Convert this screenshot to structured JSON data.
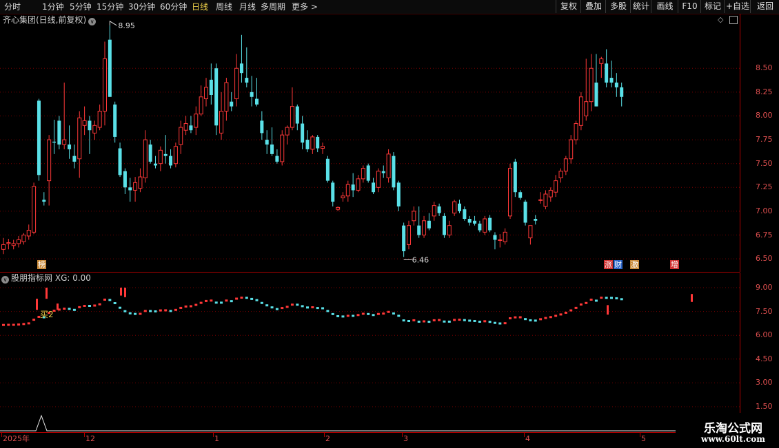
{
  "toolbar": {
    "timeframes": [
      "分时",
      "1分钟",
      "5分钟",
      "15分钟",
      "30分钟",
      "60分钟",
      "日线",
      "周线",
      "月线",
      "多周期",
      "更多 >"
    ],
    "active_index": 6,
    "right_buttons": [
      "复权",
      "叠加",
      "多股",
      "统计",
      "画线",
      "F10",
      "标记",
      "+自选",
      "返回"
    ]
  },
  "price_panel": {
    "title": "齐心集团(日线,前复权)",
    "high_label": "8.95",
    "low_label": "6.46",
    "y_ticks": [
      "8.50",
      "8.25",
      "8.00",
      "7.75",
      "7.50",
      "7.25",
      "7.00",
      "6.75",
      "6.50"
    ],
    "event_badges": [
      {
        "text": "榜",
        "color": "#c88a3a"
      },
      {
        "text": "涨",
        "color": "#d03030"
      },
      {
        "text": "财",
        "color": "#2a64c8"
      },
      {
        "text": "激",
        "color": "#c88a3a"
      },
      {
        "text": "增",
        "color": "#d03030"
      }
    ]
  },
  "indicator_panel": {
    "title": "股朋指标网",
    "xg_label": "XG: 0.00",
    "signal_label": "买2",
    "y_ticks": [
      "9.00",
      "7.50",
      "6.00",
      "4.50",
      "3.00",
      "1.50"
    ]
  },
  "x_axis": {
    "labels": [
      "2025年",
      "12",
      "1",
      "2",
      "3",
      "4",
      "5"
    ]
  },
  "watermark": {
    "title": "乐淘公式网",
    "url": "www.60lt.com"
  },
  "colors": {
    "up": "#ff3838",
    "down": "#5ae1e8",
    "grid": "#7a0000",
    "axis_text": "#e05050",
    "active_tab": "#f0d24a"
  },
  "chart_data": {
    "type": "candlestick",
    "ylim": [
      6.4,
      9.0
    ],
    "candles": [
      [
        6.6,
        6.72,
        6.55,
        6.65
      ],
      [
        6.66,
        6.71,
        6.6,
        6.67
      ],
      [
        6.64,
        6.7,
        6.6,
        6.66
      ],
      [
        6.66,
        6.74,
        6.62,
        6.7
      ],
      [
        6.68,
        6.77,
        6.65,
        6.75
      ],
      [
        6.74,
        6.86,
        6.7,
        6.8
      ],
      [
        6.78,
        7.3,
        6.76,
        7.26
      ],
      [
        8.16,
        8.18,
        7.32,
        7.38
      ],
      [
        7.12,
        7.2,
        7.06,
        7.1
      ],
      [
        7.32,
        7.8,
        7.06,
        7.75
      ],
      [
        7.73,
        7.96,
        7.6,
        7.72
      ],
      [
        7.95,
        8.0,
        7.65,
        7.7
      ],
      [
        7.7,
        8.35,
        7.65,
        7.75
      ],
      [
        7.7,
        7.9,
        7.55,
        7.65
      ],
      [
        7.58,
        7.7,
        7.45,
        7.52
      ],
      [
        7.55,
        8.05,
        7.35,
        7.98
      ],
      [
        7.9,
        8.1,
        7.8,
        7.95
      ],
      [
        7.95,
        8.0,
        7.6,
        7.85
      ],
      [
        7.82,
        7.95,
        7.75,
        7.9
      ],
      [
        7.88,
        8.12,
        7.85,
        8.05
      ],
      [
        8.05,
        8.78,
        7.9,
        8.6
      ],
      [
        8.8,
        8.95,
        8.2,
        8.2
      ],
      [
        8.12,
        8.15,
        7.72,
        7.78
      ],
      [
        7.66,
        7.72,
        7.36,
        7.38
      ],
      [
        7.42,
        7.45,
        7.18,
        7.25
      ],
      [
        7.25,
        7.35,
        7.1,
        7.22
      ],
      [
        7.22,
        7.36,
        7.1,
        7.3
      ],
      [
        7.24,
        7.45,
        7.2,
        7.36
      ],
      [
        7.35,
        7.85,
        7.3,
        7.75
      ],
      [
        7.7,
        7.75,
        7.5,
        7.52
      ],
      [
        7.5,
        7.58,
        7.45,
        7.48
      ],
      [
        7.5,
        7.68,
        7.42,
        7.64
      ],
      [
        7.6,
        7.8,
        7.5,
        7.58
      ],
      [
        7.58,
        7.65,
        7.45,
        7.48
      ],
      [
        7.5,
        7.72,
        7.46,
        7.68
      ],
      [
        7.7,
        7.95,
        7.6,
        7.88
      ],
      [
        7.85,
        8.0,
        7.8,
        7.92
      ],
      [
        7.9,
        8.0,
        7.82,
        7.85
      ],
      [
        7.88,
        8.1,
        7.8,
        8.02
      ],
      [
        8.02,
        8.32,
        8.0,
        8.2
      ],
      [
        8.18,
        8.4,
        8.1,
        8.3
      ],
      [
        8.38,
        8.55,
        8.12,
        8.22
      ],
      [
        8.5,
        8.55,
        7.8,
        7.9
      ],
      [
        7.82,
        8.25,
        7.75,
        8.05
      ],
      [
        8.05,
        8.4,
        7.95,
        8.35
      ],
      [
        8.15,
        8.25,
        8.05,
        8.1
      ],
      [
        8.18,
        8.65,
        8.1,
        8.5
      ],
      [
        8.55,
        8.85,
        8.35,
        8.45
      ],
      [
        8.4,
        8.72,
        8.3,
        8.35
      ],
      [
        8.25,
        8.42,
        8.1,
        8.2
      ],
      [
        8.18,
        8.4,
        8.1,
        8.12
      ],
      [
        7.95,
        8.05,
        7.75,
        7.82
      ],
      [
        7.75,
        7.85,
        7.6,
        7.7
      ],
      [
        7.7,
        7.88,
        7.58,
        7.6
      ],
      [
        7.58,
        7.65,
        7.5,
        7.52
      ],
      [
        7.52,
        7.85,
        7.48,
        7.8
      ],
      [
        7.8,
        7.9,
        7.7,
        7.88
      ],
      [
        7.88,
        8.3,
        7.85,
        8.1
      ],
      [
        8.1,
        8.12,
        7.85,
        7.92
      ],
      [
        7.92,
        8.0,
        7.65,
        7.72
      ],
      [
        7.75,
        7.85,
        7.62,
        7.65
      ],
      [
        7.65,
        7.8,
        7.6,
        7.78
      ],
      [
        7.78,
        7.8,
        7.62,
        7.66
      ],
      [
        7.66,
        7.72,
        7.6,
        7.68
      ],
      [
        7.55,
        7.58,
        7.3,
        7.32
      ],
      [
        7.3,
        7.32,
        7.05,
        7.1
      ],
      [
        7.02,
        7.05,
        7.0,
        7.04
      ],
      [
        7.14,
        7.2,
        7.1,
        7.16
      ],
      [
        7.16,
        7.32,
        7.1,
        7.28
      ],
      [
        7.28,
        7.4,
        7.15,
        7.22
      ],
      [
        7.22,
        7.38,
        7.2,
        7.34
      ],
      [
        7.34,
        7.48,
        7.3,
        7.45
      ],
      [
        7.48,
        7.5,
        7.3,
        7.32
      ],
      [
        7.3,
        7.35,
        7.18,
        7.2
      ],
      [
        7.25,
        7.45,
        7.2,
        7.42
      ],
      [
        7.42,
        7.48,
        7.35,
        7.4
      ],
      [
        7.35,
        7.65,
        7.3,
        7.6
      ],
      [
        7.58,
        7.62,
        7.22,
        7.25
      ],
      [
        7.3,
        7.32,
        7.0,
        7.05
      ],
      [
        6.85,
        6.88,
        6.52,
        6.58
      ],
      [
        6.65,
        6.9,
        6.6,
        6.85
      ],
      [
        6.9,
        7.05,
        6.85,
        7.0
      ],
      [
        6.85,
        7.05,
        6.72,
        6.75
      ],
      [
        6.75,
        6.95,
        6.72,
        6.9
      ],
      [
        6.9,
        6.98,
        6.8,
        6.82
      ],
      [
        6.95,
        7.1,
        6.9,
        7.06
      ],
      [
        7.05,
        7.08,
        6.95,
        6.98
      ],
      [
        6.95,
        6.98,
        6.72,
        6.75
      ],
      [
        6.75,
        6.9,
        6.72,
        6.85
      ],
      [
        6.98,
        7.12,
        6.95,
        7.1
      ],
      [
        7.08,
        7.12,
        6.98,
        7.0
      ],
      [
        7.02,
        7.05,
        6.9,
        6.92
      ],
      [
        6.92,
        6.95,
        6.85,
        6.88
      ],
      [
        6.9,
        6.95,
        6.85,
        6.87
      ],
      [
        6.87,
        6.9,
        6.78,
        6.8
      ],
      [
        6.78,
        6.95,
        6.75,
        6.92
      ],
      [
        6.93,
        6.96,
        6.78,
        6.8
      ],
      [
        6.75,
        6.78,
        6.6,
        6.7
      ],
      [
        6.7,
        6.76,
        6.62,
        6.7
      ],
      [
        6.68,
        6.82,
        6.65,
        6.78
      ],
      [
        6.95,
        7.5,
        6.92,
        7.45
      ],
      [
        7.52,
        7.55,
        7.15,
        7.2
      ],
      [
        7.2,
        7.22,
        7.12,
        7.14
      ],
      [
        7.1,
        7.12,
        6.85,
        6.88
      ],
      [
        6.72,
        6.85,
        6.65,
        6.85
      ],
      [
        6.92,
        6.96,
        6.86,
        6.9
      ],
      [
        7.12,
        7.2,
        7.08,
        7.12
      ],
      [
        7.05,
        7.22,
        7.02,
        7.18
      ],
      [
        7.15,
        7.25,
        7.1,
        7.22
      ],
      [
        7.2,
        7.38,
        7.15,
        7.32
      ],
      [
        7.35,
        7.45,
        7.3,
        7.42
      ],
      [
        7.42,
        7.58,
        7.38,
        7.55
      ],
      [
        7.55,
        7.8,
        7.5,
        7.75
      ],
      [
        7.75,
        7.95,
        7.7,
        7.92
      ],
      [
        7.9,
        8.25,
        7.85,
        8.2
      ],
      [
        8.0,
        8.6,
        7.95,
        8.15
      ],
      [
        8.15,
        8.65,
        8.05,
        8.5
      ],
      [
        8.35,
        8.65,
        8.1,
        8.1
      ],
      [
        8.55,
        8.62,
        8.4,
        8.6
      ],
      [
        8.55,
        8.7,
        8.3,
        8.35
      ],
      [
        8.4,
        8.58,
        8.3,
        8.35
      ],
      [
        8.35,
        8.45,
        8.2,
        8.3
      ],
      [
        8.3,
        8.35,
        8.1,
        8.2
      ]
    ]
  }
}
